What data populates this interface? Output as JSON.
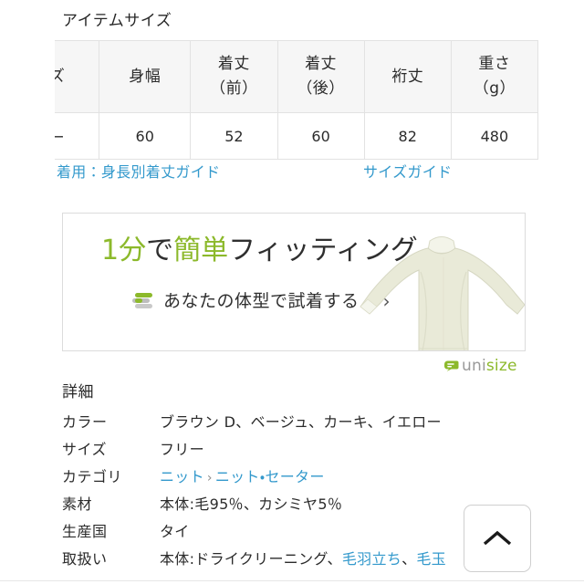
{
  "size_section": {
    "heading": "アイテムサイズ",
    "table": {
      "headers": [
        {
          "main": "ズ",
          "sub": ""
        },
        {
          "main": "身幅",
          "sub": ""
        },
        {
          "main": "着丈",
          "sub": "（前）"
        },
        {
          "main": "着丈",
          "sub": "（後）"
        },
        {
          "main": "裄丈",
          "sub": ""
        },
        {
          "main": "重さ",
          "sub": "（g）"
        }
      ],
      "rows": [
        [
          "ー",
          "60",
          "52",
          "60",
          "82",
          "480"
        ]
      ]
    },
    "links": {
      "wear_guide": "着用：身長別着丈ガイド",
      "size_guide": "サイズガイド"
    }
  },
  "fitting_banner": {
    "headline_parts": [
      {
        "text": "1分",
        "color": "green"
      },
      {
        "text": "で",
        "color": "dark"
      },
      {
        "text": "簡単",
        "color": "green"
      },
      {
        "text": "フィッティング",
        "color": "dark"
      }
    ],
    "headline_full": "1分で簡単フィッティング",
    "cta_label": "あなたの体型で試着する",
    "cta_chevron": "›",
    "logo": {
      "uni": "uni",
      "size": "size"
    }
  },
  "details": {
    "heading": "詳細",
    "rows": [
      {
        "label": "カラー",
        "value": "ブラウン D、ベージュ、カーキ、イエロー",
        "type": "text"
      },
      {
        "label": "サイズ",
        "value": "フリー",
        "type": "text"
      },
      {
        "label": "カテゴリ",
        "value": "ニット > ニット・セーター",
        "type": "breadcrumb",
        "crumbs": [
          "ニット",
          "ニット・セーター"
        ],
        "separator": "›"
      },
      {
        "label": "素材",
        "value": "本体:毛95％、カシミヤ5％",
        "type": "text"
      },
      {
        "label": "生産国",
        "value": "タイ",
        "type": "text"
      },
      {
        "label": "取扱い",
        "value": "本体:ドライクリーニング、毛羽立ち、毛玉",
        "type": "mixed",
        "plain": "本体:ドライクリーニング、",
        "link1": "毛羽立ち",
        "mid": "、",
        "link2": "毛玉"
      }
    ]
  },
  "scroll_top": {
    "label": "^"
  },
  "colors": {
    "link_blue": "#3399cc",
    "accent_green": "#8cb92b",
    "text_dark": "#2b2b2b",
    "table_header_bg": "#f6f6f6",
    "border_gray": "#e2e2e2",
    "sweater_cream": "#e9ead8"
  }
}
